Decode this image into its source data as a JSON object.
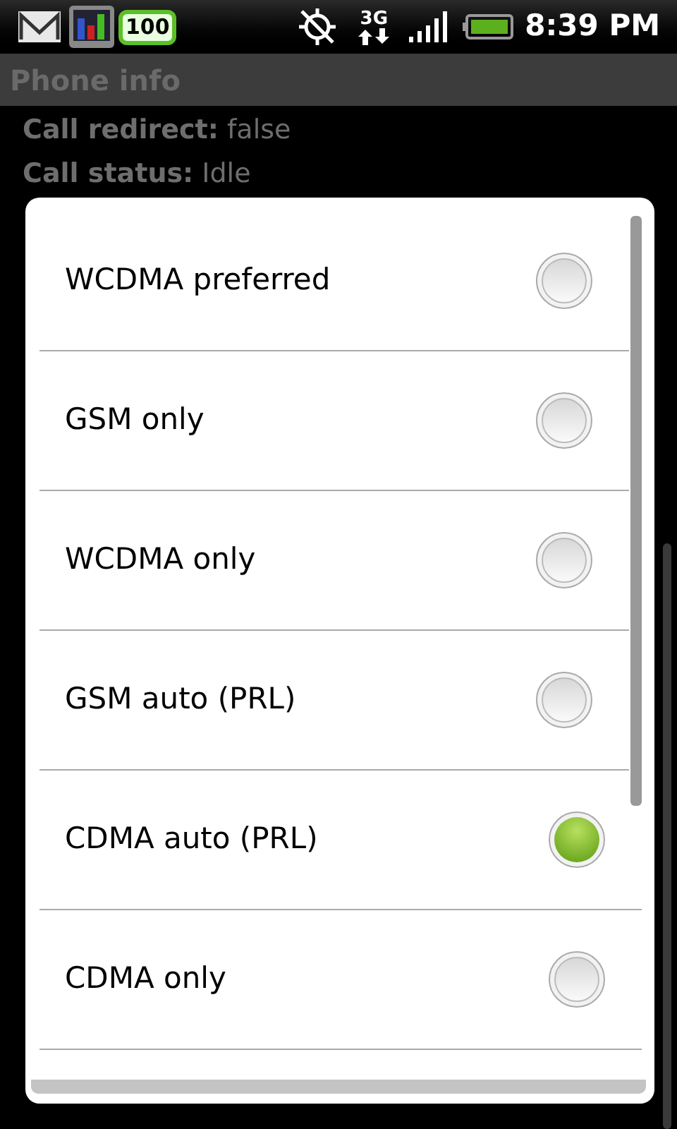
{
  "status_bar": {
    "badge": "100",
    "network": "3G",
    "time": "8:39 PM"
  },
  "window": {
    "title": "Phone info"
  },
  "info_rows": [
    {
      "label": "Call redirect:",
      "value": "false"
    },
    {
      "label": "Call status:",
      "value": "Idle"
    }
  ],
  "dialog": {
    "options": [
      {
        "label": "WCDMA preferred",
        "selected": false
      },
      {
        "label": "GSM only",
        "selected": false
      },
      {
        "label": "WCDMA only",
        "selected": false
      },
      {
        "label": "GSM auto (PRL)",
        "selected": false
      },
      {
        "label": "CDMA auto (PRL)",
        "selected": true
      },
      {
        "label": "CDMA only",
        "selected": false
      }
    ]
  }
}
